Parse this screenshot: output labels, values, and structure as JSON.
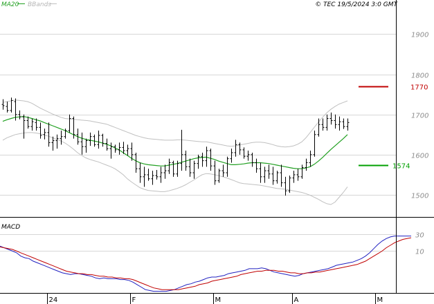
{
  "header": {
    "legend_ma": "MA20",
    "legend_bbands": "BBands",
    "source": "© TEC 19/5/2024 3:0 GMT"
  },
  "colors": {
    "ma20": "#21a021",
    "bbands": "#c0c0c0",
    "candles": "#000000",
    "resistance": "#c00000",
    "support": "#00a000",
    "macd": "#2020c0",
    "signal": "#c00000",
    "grid": "#d6d6d6"
  },
  "chart_data": [
    {
      "type": "ohlc",
      "title": "",
      "price_ticks": [
        "1900",
        "1800",
        "1700",
        "1600",
        "1500"
      ],
      "price_tick_values": [
        1900,
        1800,
        1700,
        1600,
        1500
      ],
      "ylim": [
        1445,
        1985
      ],
      "x_labels": [
        {
          "label": "24",
          "bar": 13
        },
        {
          "label": "F",
          "bar": 33
        },
        {
          "label": "M",
          "bar": 53
        },
        {
          "label": "A",
          "bar": 72
        },
        {
          "label": "M",
          "bar": 92
        }
      ],
      "levels": [
        {
          "name": "resistance",
          "value": 1770,
          "label": "1770"
        },
        {
          "name": "support",
          "value": 1574,
          "label": "1574"
        }
      ],
      "bars": [
        [
          1725,
          1738,
          1712,
          1722
        ],
        [
          1720,
          1732,
          1705,
          1710
        ],
        [
          1710,
          1742,
          1705,
          1735
        ],
        [
          1732,
          1740,
          1685,
          1700
        ],
        [
          1700,
          1710,
          1688,
          1694
        ],
        [
          1694,
          1700,
          1640,
          1685
        ],
        [
          1685,
          1695,
          1665,
          1670
        ],
        [
          1670,
          1690,
          1660,
          1682
        ],
        [
          1680,
          1690,
          1660,
          1668
        ],
        [
          1668,
          1680,
          1640,
          1648
        ],
        [
          1650,
          1665,
          1638,
          1655
        ],
        [
          1655,
          1680,
          1620,
          1630
        ],
        [
          1630,
          1645,
          1610,
          1635
        ],
        [
          1635,
          1650,
          1615,
          1640
        ],
        [
          1640,
          1660,
          1625,
          1645
        ],
        [
          1645,
          1665,
          1640,
          1660
        ],
        [
          1660,
          1700,
          1655,
          1690
        ],
        [
          1690,
          1695,
          1640,
          1650
        ],
        [
          1650,
          1665,
          1625,
          1632
        ],
        [
          1632,
          1655,
          1600,
          1620
        ],
        [
          1620,
          1640,
          1605,
          1635
        ],
        [
          1635,
          1655,
          1622,
          1645
        ],
        [
          1645,
          1650,
          1620,
          1625
        ],
        [
          1625,
          1660,
          1615,
          1648
        ],
        [
          1648,
          1652,
          1620,
          1628
        ],
        [
          1628,
          1640,
          1610,
          1615
        ],
        [
          1615,
          1630,
          1590,
          1620
        ],
        [
          1620,
          1625,
          1605,
          1612
        ],
        [
          1612,
          1630,
          1600,
          1618
        ],
        [
          1618,
          1632,
          1602,
          1610
        ],
        [
          1610,
          1625,
          1598,
          1615
        ],
        [
          1615,
          1630,
          1585,
          1600
        ],
        [
          1600,
          1605,
          1555,
          1565
        ],
        [
          1565,
          1580,
          1530,
          1545
        ],
        [
          1545,
          1570,
          1520,
          1550
        ],
        [
          1550,
          1565,
          1535,
          1540
        ],
        [
          1540,
          1560,
          1525,
          1548
        ],
        [
          1548,
          1562,
          1538,
          1545
        ],
        [
          1545,
          1570,
          1530,
          1555
        ],
        [
          1555,
          1575,
          1540,
          1560
        ],
        [
          1560,
          1590,
          1552,
          1580
        ],
        [
          1580,
          1585,
          1545,
          1552
        ],
        [
          1552,
          1585,
          1545,
          1578
        ],
        [
          1578,
          1662,
          1560,
          1600
        ],
        [
          1600,
          1610,
          1560,
          1570
        ],
        [
          1570,
          1590,
          1545,
          1555
        ],
        [
          1555,
          1585,
          1540,
          1578
        ],
        [
          1578,
          1600,
          1565,
          1595
        ],
        [
          1595,
          1605,
          1570,
          1585
        ],
        [
          1585,
          1620,
          1570,
          1610
        ],
        [
          1610,
          1615,
          1560,
          1572
        ],
        [
          1572,
          1585,
          1525,
          1535
        ],
        [
          1535,
          1565,
          1530,
          1560
        ],
        [
          1560,
          1575,
          1545,
          1555
        ],
        [
          1555,
          1595,
          1545,
          1590
        ],
        [
          1590,
          1615,
          1580,
          1605
        ],
        [
          1605,
          1637,
          1595,
          1625
        ],
        [
          1625,
          1630,
          1600,
          1612
        ],
        [
          1612,
          1618,
          1590,
          1596
        ],
        [
          1596,
          1610,
          1585,
          1600
        ],
        [
          1600,
          1605,
          1570,
          1580
        ],
        [
          1580,
          1590,
          1555,
          1565
        ],
        [
          1565,
          1580,
          1530,
          1545
        ],
        [
          1545,
          1570,
          1530,
          1560
        ],
        [
          1560,
          1575,
          1540,
          1552
        ],
        [
          1552,
          1570,
          1525,
          1535
        ],
        [
          1535,
          1560,
          1528,
          1555
        ],
        [
          1555,
          1575,
          1520,
          1530
        ],
        [
          1530,
          1545,
          1498,
          1510
        ],
        [
          1510,
          1548,
          1505,
          1542
        ],
        [
          1542,
          1560,
          1530,
          1550
        ],
        [
          1550,
          1565,
          1535,
          1545
        ],
        [
          1545,
          1575,
          1540,
          1568
        ],
        [
          1568,
          1590,
          1560,
          1580
        ],
        [
          1580,
          1610,
          1570,
          1600
        ],
        [
          1600,
          1660,
          1595,
          1650
        ],
        [
          1650,
          1690,
          1645,
          1675
        ],
        [
          1675,
          1690,
          1660,
          1668
        ],
        [
          1668,
          1700,
          1660,
          1690
        ],
        [
          1690,
          1705,
          1675,
          1685
        ],
        [
          1685,
          1700,
          1665,
          1675
        ],
        [
          1675,
          1695,
          1660,
          1682
        ],
        [
          1682,
          1690,
          1664,
          1670
        ],
        [
          1670,
          1690,
          1660,
          1680
        ]
      ],
      "ma20": [
        1683,
        1687,
        1690,
        1693,
        1694,
        1695,
        1693,
        1690,
        1687,
        1684,
        1680,
        1676,
        1672,
        1668,
        1664,
        1660,
        1655,
        1650,
        1645,
        1641,
        1638,
        1636,
        1634,
        1632,
        1629,
        1626,
        1622,
        1617,
        1612,
        1605,
        1598,
        1591,
        1585,
        1580,
        1577,
        1575,
        1574,
        1573,
        1572,
        1572,
        1574,
        1576,
        1578,
        1581,
        1584,
        1587,
        1590,
        1592,
        1593,
        1594,
        1591,
        1588,
        1584,
        1581,
        1578,
        1575,
        1575,
        1576,
        1577,
        1579,
        1580,
        1580,
        1580,
        1579,
        1578,
        1576,
        1574,
        1572,
        1570,
        1568,
        1566,
        1565,
        1565,
        1567,
        1570,
        1576,
        1584,
        1593,
        1603,
        1613,
        1622,
        1631,
        1640,
        1650
      ],
      "bb_upper": [
        1730,
        1732,
        1734,
        1736,
        1735,
        1734,
        1732,
        1728,
        1722,
        1716,
        1711,
        1706,
        1701,
        1697,
        1693,
        1690,
        1689,
        1688,
        1687,
        1686,
        1685,
        1684,
        1682,
        1680,
        1678,
        1676,
        1672,
        1668,
        1664,
        1660,
        1656,
        1652,
        1648,
        1645,
        1642,
        1640,
        1639,
        1638,
        1637,
        1636,
        1636,
        1636,
        1637,
        1637,
        1636,
        1635,
        1634,
        1633,
        1632,
        1632,
        1630,
        1628,
        1626,
        1624,
        1622,
        1621,
        1622,
        1624,
        1626,
        1628,
        1630,
        1631,
        1631,
        1630,
        1628,
        1625,
        1622,
        1620,
        1619,
        1620,
        1622,
        1626,
        1632,
        1642,
        1655,
        1668,
        1681,
        1693,
        1704,
        1713,
        1720,
        1726,
        1730,
        1734
      ],
      "bb_lower": [
        1636,
        1642,
        1646,
        1650,
        1652,
        1654,
        1655,
        1655,
        1654,
        1652,
        1649,
        1646,
        1642,
        1638,
        1634,
        1629,
        1622,
        1614,
        1605,
        1598,
        1592,
        1588,
        1585,
        1582,
        1578,
        1574,
        1570,
        1565,
        1558,
        1550,
        1540,
        1532,
        1525,
        1518,
        1514,
        1511,
        1510,
        1509,
        1508,
        1508,
        1510,
        1513,
        1516,
        1520,
        1525,
        1531,
        1537,
        1544,
        1550,
        1553,
        1552,
        1550,
        1548,
        1545,
        1542,
        1538,
        1534,
        1530,
        1528,
        1527,
        1526,
        1525,
        1524,
        1522,
        1520,
        1518,
        1516,
        1515,
        1514,
        1512,
        1510,
        1508,
        1506,
        1503,
        1499,
        1494,
        1489,
        1483,
        1478,
        1476,
        1482,
        1494,
        1506,
        1520
      ]
    },
    {
      "type": "line",
      "title": "MACD",
      "y_ticks": [
        "30",
        "10"
      ],
      "y_tick_values": [
        30,
        10
      ],
      "ylim": [
        -40,
        50
      ],
      "series": [
        {
          "key": "macd",
          "values": [
            16,
            14,
            12,
            10,
            8,
            4,
            2,
            1,
            -2,
            -4,
            -6,
            -8,
            -10,
            -12,
            -14,
            -16,
            -17,
            -18,
            -17,
            -17,
            -18,
            -19,
            -20,
            -22,
            -23,
            -22,
            -23,
            -23,
            -23,
            -24,
            -24,
            -25,
            -27,
            -30,
            -33,
            -36,
            -37,
            -38,
            -38,
            -38,
            -38,
            -37,
            -36,
            -34,
            -32,
            -30,
            -29,
            -27,
            -26,
            -24,
            -22,
            -21,
            -21,
            -20,
            -19,
            -17,
            -16,
            -15,
            -14,
            -13,
            -11,
            -11,
            -11,
            -10,
            -11,
            -13,
            -15,
            -16,
            -17,
            -18,
            -19,
            -20,
            -19,
            -17,
            -16,
            -15,
            -14,
            -13,
            -12,
            -11,
            -9,
            -7,
            -6,
            -5,
            -4,
            -3,
            -1,
            1,
            4,
            8,
            13,
            18,
            22,
            25,
            27,
            28,
            28,
            28,
            28,
            28
          ]
        },
        {
          "key": "signal",
          "values": [
            15,
            14,
            13,
            12,
            10,
            8,
            6,
            4,
            2,
            0,
            -2,
            -4,
            -6,
            -8,
            -10,
            -12,
            -14,
            -15,
            -16,
            -17,
            -17,
            -18,
            -18,
            -19,
            -20,
            -20,
            -21,
            -21,
            -22,
            -22,
            -23,
            -23,
            -24,
            -26,
            -28,
            -30,
            -32,
            -34,
            -35,
            -36,
            -36,
            -36,
            -36,
            -36,
            -35,
            -34,
            -33,
            -32,
            -30,
            -29,
            -28,
            -26,
            -25,
            -24,
            -23,
            -22,
            -21,
            -20,
            -18,
            -17,
            -16,
            -15,
            -14,
            -14,
            -13,
            -13,
            -13,
            -14,
            -14,
            -15,
            -16,
            -16,
            -17,
            -17,
            -16,
            -16,
            -15,
            -15,
            -14,
            -13,
            -12,
            -11,
            -10,
            -9,
            -8,
            -7,
            -6,
            -4,
            -2,
            1,
            4,
            7,
            10,
            14,
            17,
            20,
            22,
            24,
            25,
            26
          ]
        }
      ]
    }
  ]
}
